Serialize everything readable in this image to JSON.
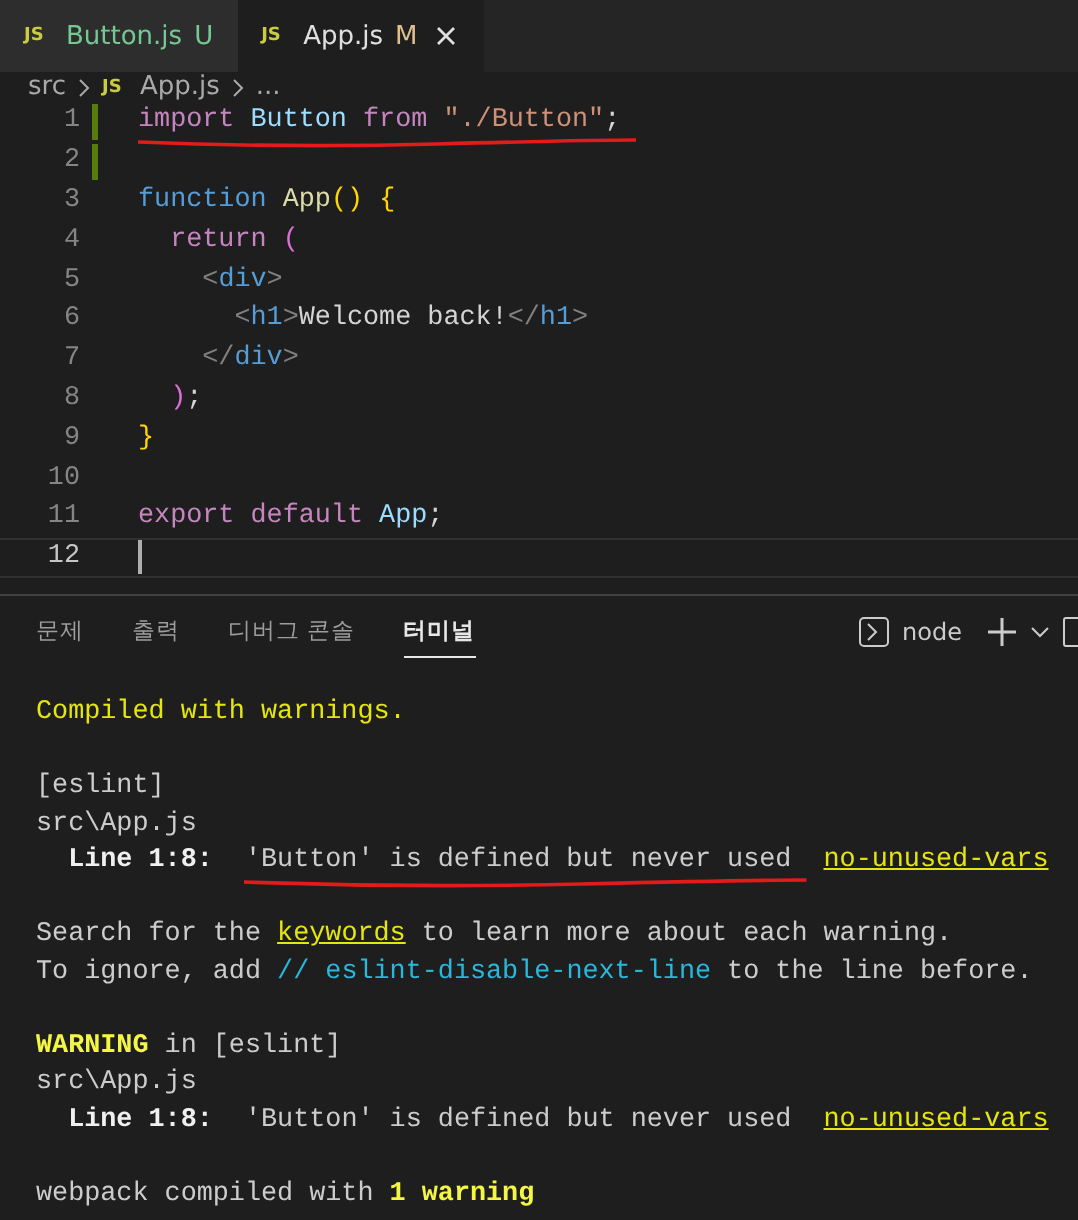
{
  "tabs": [
    {
      "icon": "JS",
      "label": "Button.js",
      "status": "U",
      "selected": false,
      "closable": false
    },
    {
      "icon": "JS",
      "label": "App.js",
      "status": "M",
      "selected": true,
      "closable": true
    }
  ],
  "breadcrumb": {
    "folder": "src",
    "icon": "JS",
    "file": "App.js",
    "more": "..."
  },
  "editor": {
    "lines": [
      {
        "number": "1",
        "modified": true,
        "current": false,
        "underlined": true,
        "tokens": [
          {
            "text": "import",
            "kind": "keyword"
          },
          {
            "text": " Button ",
            "kind": "variable"
          },
          {
            "text": "from",
            "kind": "keyword"
          },
          {
            "text": " \"./Button\"",
            "kind": "string"
          },
          {
            "text": ";",
            "kind": "plain"
          }
        ]
      },
      {
        "number": "2",
        "modified": true,
        "current": false,
        "underlined": false
      },
      {
        "number": "3",
        "modified": false,
        "current": false,
        "underlined": false,
        "tokens": [
          {
            "text": "function",
            "kind": "storage"
          },
          {
            "text": " App",
            "kind": "function"
          },
          {
            "text": "()",
            "kind": "bracket"
          },
          {
            "text": " {",
            "kind": "bracket"
          }
        ]
      },
      {
        "number": "4",
        "modified": false,
        "current": false,
        "underlined": false,
        "tokens": [
          {
            "text": "  return",
            "kind": "keyword"
          },
          {
            "text": " (",
            "kind": "bracket2"
          }
        ]
      },
      {
        "number": "5",
        "modified": false,
        "current": false,
        "underlined": false,
        "tokens": [
          {
            "text": "    <",
            "kind": "punct"
          },
          {
            "text": "div",
            "kind": "tag"
          },
          {
            "text": ">",
            "kind": "punct"
          }
        ]
      },
      {
        "number": "6",
        "modified": false,
        "current": false,
        "underlined": false,
        "tokens": [
          {
            "text": "      <",
            "kind": "punct"
          },
          {
            "text": "h1",
            "kind": "tag"
          },
          {
            "text": ">",
            "kind": "punct"
          },
          {
            "text": "Welcome back!",
            "kind": "plain"
          },
          {
            "text": "</",
            "kind": "punct"
          },
          {
            "text": "h1",
            "kind": "tag"
          },
          {
            "text": ">",
            "kind": "punct"
          }
        ]
      },
      {
        "number": "7",
        "modified": false,
        "current": false,
        "underlined": false,
        "tokens": [
          {
            "text": "    </",
            "kind": "punct"
          },
          {
            "text": "div",
            "kind": "tag"
          },
          {
            "text": ">",
            "kind": "punct"
          }
        ]
      },
      {
        "number": "8",
        "modified": false,
        "current": false,
        "underlined": false,
        "tokens": [
          {
            "text": "  )",
            "kind": "bracket2"
          },
          {
            "text": ";",
            "kind": "plain"
          }
        ]
      },
      {
        "number": "9",
        "modified": false,
        "current": false,
        "underlined": false,
        "tokens": [
          {
            "text": "}",
            "kind": "bracket"
          }
        ]
      },
      {
        "number": "10",
        "modified": false,
        "current": false,
        "underlined": false
      },
      {
        "number": "11",
        "modified": false,
        "current": false,
        "underlined": false,
        "tokens": [
          {
            "text": "export",
            "kind": "keyword"
          },
          {
            "text": " default",
            "kind": "keyword"
          },
          {
            "text": " App",
            "kind": "variable"
          },
          {
            "text": ";",
            "kind": "plain"
          }
        ]
      },
      {
        "number": "12",
        "modified": false,
        "current": true,
        "underlined": false
      }
    ]
  },
  "panel": {
    "tabs": [
      {
        "label": "문제",
        "selected": false
      },
      {
        "label": "출력",
        "selected": false
      },
      {
        "label": "디버그 콘솔",
        "selected": false
      },
      {
        "label": "터미널",
        "selected": true
      }
    ],
    "terminal_name": "node",
    "blocks": [
      [
        [
          {
            "text": "Compiled with warnings.",
            "kind": "yellow"
          }
        ]
      ],
      [
        [
          {
            "text": "[eslint]",
            "kind": "plain"
          }
        ],
        [
          {
            "text": "src\\App.js",
            "kind": "plain"
          }
        ],
        [
          {
            "text": "  Line 1:8:",
            "kind": "bold"
          },
          {
            "text": "'Button' is defined but never used",
            "kind": "underlined"
          },
          {
            "text": "no-unused-vars",
            "kind": "rule"
          }
        ]
      ],
      [
        [
          {
            "text": "Search for the ",
            "kind": "plain"
          },
          {
            "text": "keywords",
            "kind": "link"
          },
          {
            "text": " to learn more about each warning.",
            "kind": "plain"
          }
        ],
        [
          {
            "text": "To ignore, add ",
            "kind": "plain"
          },
          {
            "text": "// eslint-disable-next-line",
            "kind": "comment"
          },
          {
            "text": " to the line before.",
            "kind": "plain"
          }
        ]
      ],
      [
        [
          {
            "text": "WARNING",
            "kind": "boldyellow"
          },
          {
            "text": " in [eslint]",
            "kind": "plain"
          }
        ],
        [
          {
            "text": "src\\App.js",
            "kind": "plain"
          }
        ],
        [
          {
            "text": "  Line 1:8:",
            "kind": "bold"
          },
          {
            "text": "  'Button' is defined but never used",
            "kind": "plain"
          },
          {
            "text": "no-unused-vars",
            "kind": "rule"
          }
        ]
      ],
      [
        [
          {
            "text": "webpack compiled with ",
            "kind": "plain"
          },
          {
            "text": "1 warning",
            "kind": "boldyellow"
          }
        ]
      ]
    ]
  }
}
